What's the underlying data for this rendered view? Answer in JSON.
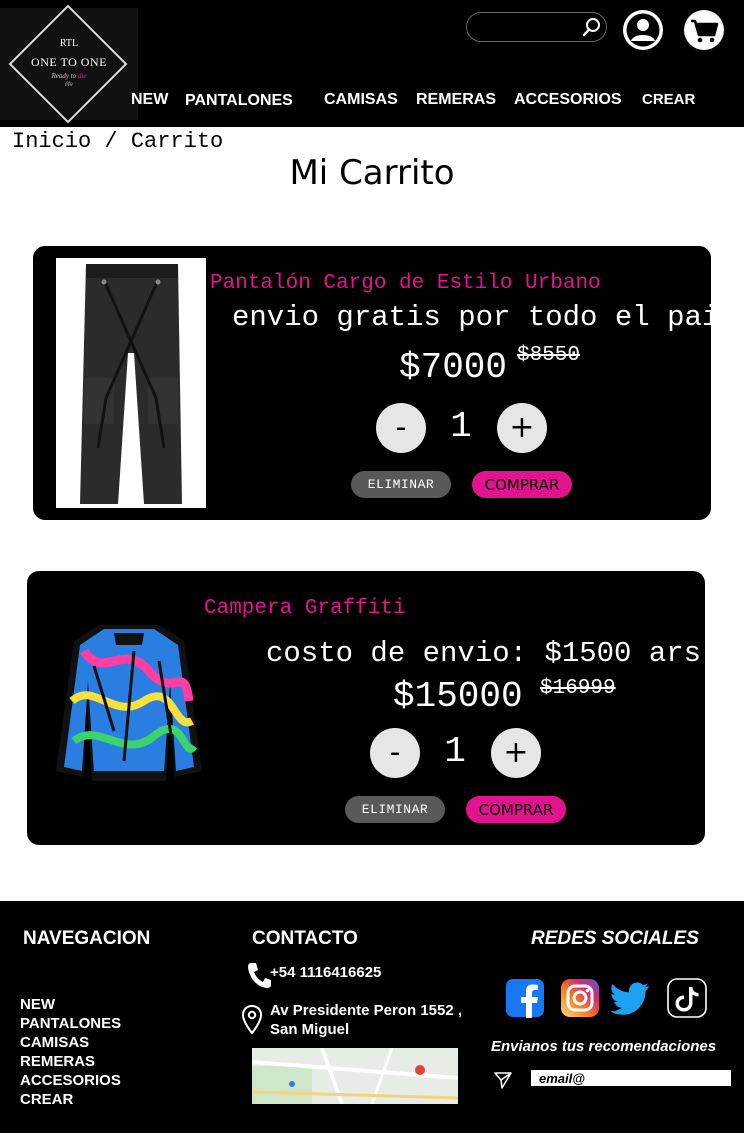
{
  "brand": {
    "monogram": "RTL",
    "name": "ONE TO ONE",
    "tagline_before": "Ready to ",
    "tagline_accent": "die",
    "small": "life"
  },
  "search": {
    "placeholder": "",
    "icon": "search-icon"
  },
  "header_icons": [
    "user-icon",
    "cart-icon"
  ],
  "nav": {
    "new": "NEW",
    "pantalones": "PANTALONES",
    "camisas": "CAMISAS",
    "remeras": "REMERAS",
    "accesorios": "ACCESORIOS",
    "crear": "CREAR"
  },
  "breadcrumb": "Inicio / Carrito",
  "page_title": "Mi Carrito",
  "cart_items": [
    {
      "name": "Pantalón Cargo de Estilo Urbano",
      "shipping": "envio gratis por todo el pais",
      "price": "$7000",
      "old_price": "$8550",
      "quantity": "1",
      "minus": "-",
      "plus": "+",
      "delete_label": "ELIMINAR",
      "buy_label": "COMPRAR"
    },
    {
      "name": "Campera Graffiti",
      "shipping": "costo de envio: $1500 ars",
      "price": "$15000",
      "old_price": "$16999",
      "quantity": "1",
      "minus": "-",
      "plus": "+",
      "delete_label": "ELIMINAR",
      "buy_label": "COMPRAR"
    }
  ],
  "footer": {
    "nav_title": "NAVEGACION",
    "nav_links": [
      "NEW",
      "PANTALONES",
      "CAMISAS",
      "REMERAS",
      "ACCESORIOS",
      "CREAR"
    ],
    "contact_title": "CONTACTO",
    "phone": "+54 1116416625",
    "address_line1": "Av Presidente Peron 1552 ,",
    "address_line2": "San Miguel",
    "social_title": "REDES SOCIALES",
    "social_icons": [
      "facebook-icon",
      "instagram-icon",
      "twitter-icon",
      "tiktok-icon"
    ],
    "recommend_label": "Envianos tus recomendaciones",
    "email_placeholder": "email@"
  },
  "colors": {
    "accent": "#e3128f",
    "header_bg": "#000000",
    "card_bg": "#000000",
    "delete_bg": "#595959",
    "qty_bg": "#e6e6e6"
  }
}
